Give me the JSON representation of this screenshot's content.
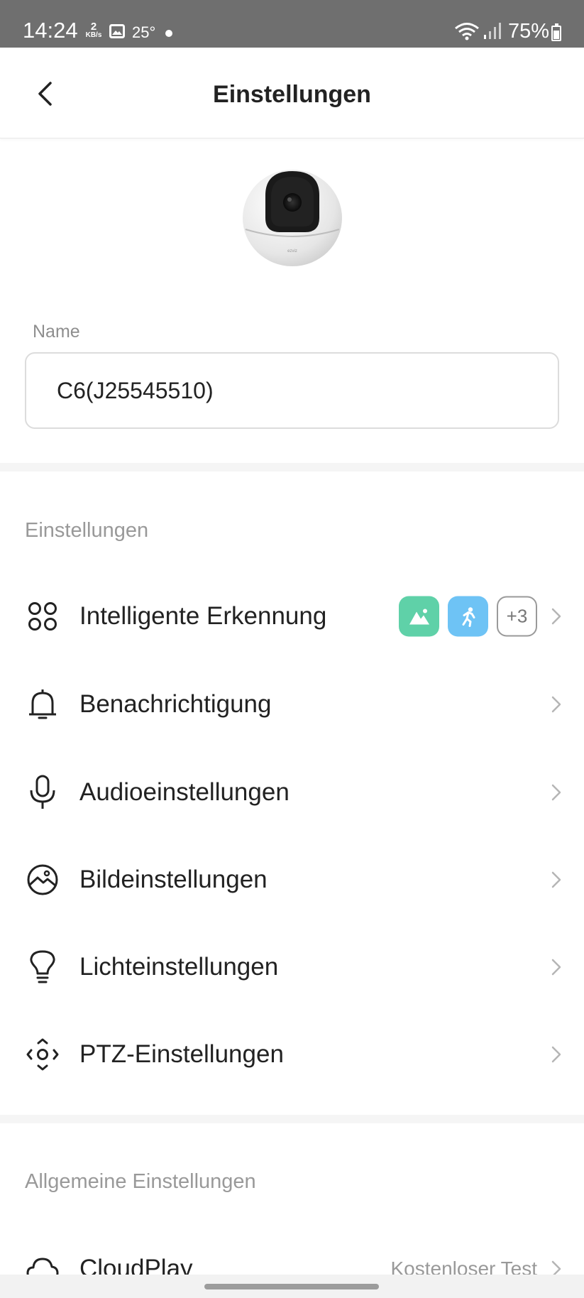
{
  "status_bar": {
    "time": "14:24",
    "net_speed_value": "2",
    "net_speed_unit": "KB/s",
    "temperature": "25°",
    "battery": "75%"
  },
  "header": {
    "title": "Einstellungen"
  },
  "name_section": {
    "label": "Name",
    "value": "C6(J25545510)"
  },
  "settings_section": {
    "title": "Einstellungen",
    "items": [
      {
        "label": "Intelligente Erkennung",
        "icon": "smart-detection-icon",
        "extra_badges": "+3"
      },
      {
        "label": "Benachrichtigung",
        "icon": "bell-icon"
      },
      {
        "label": "Audioeinstellungen",
        "icon": "microphone-icon"
      },
      {
        "label": "Bildeinstellungen",
        "icon": "image-icon"
      },
      {
        "label": "Lichteinstellungen",
        "icon": "lightbulb-icon"
      },
      {
        "label": "PTZ-Einstellungen",
        "icon": "ptz-icon"
      }
    ]
  },
  "general_section": {
    "title": "Allgemeine Einstellungen",
    "items": [
      {
        "label": "CloudPlay",
        "icon": "cloud-icon",
        "value": "Kostenloser Test"
      }
    ]
  },
  "colors": {
    "badge_green": "#5fd1a8",
    "badge_blue": "#6ec3f5",
    "status_bar": "#6f6f6f"
  }
}
